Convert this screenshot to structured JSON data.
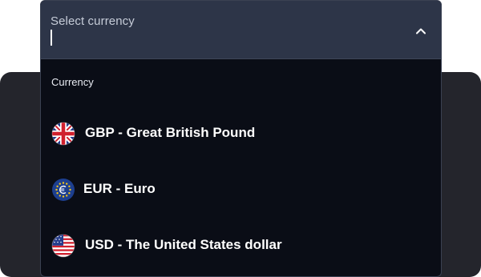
{
  "combo": {
    "label": "Select currency",
    "value": "",
    "toggle_icon": "chevron-up-icon"
  },
  "list": {
    "section_header": "Currency",
    "options": [
      {
        "label": "GBP - Great British Pound",
        "icon": "uk-flag-icon"
      },
      {
        "label": "EUR - Euro",
        "icon": "eu-flag-icon"
      },
      {
        "label": "USD - The United States dollar",
        "icon": "us-flag-icon"
      }
    ]
  },
  "colors": {
    "surface": "#0a0d16",
    "field": "#2d3548",
    "backdrop": "#24252c",
    "text": "#ffffff"
  }
}
